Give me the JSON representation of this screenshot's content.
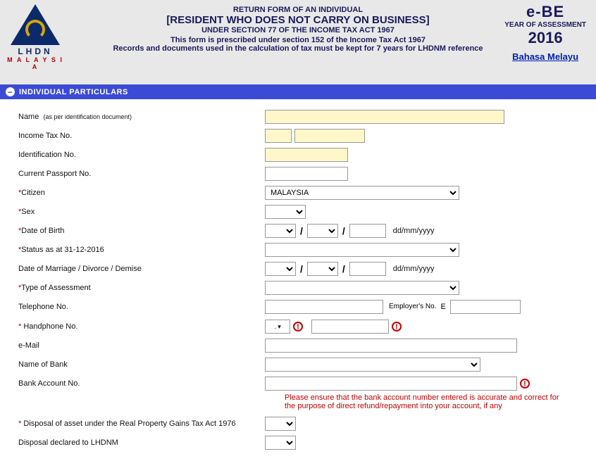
{
  "header": {
    "line1": "RETURN FORM OF AN INDIVIDUAL",
    "line2": "[RESIDENT WHO DOES NOT CARRY ON BUSINESS]",
    "line3": "UNDER SECTION 77 OF THE INCOME TAX ACT 1967",
    "line4": "This form is prescribed under section 152 of the Income Tax Act 1967",
    "line5": "Records and documents used in the calculation of tax must be kept for 7 years for LHDNM reference",
    "logo_lhdn": "LHDN",
    "logo_malaysia": "M A L A Y S I A",
    "ebe": "e-BE",
    "year_of": "YEAR OF ASSESSMENT",
    "year": "2016",
    "lang_link": "Bahasa Melayu"
  },
  "section": {
    "title": "INDIVIDUAL PARTICULARS"
  },
  "labels": {
    "name": "Name",
    "name_hint": "(as per identification document)",
    "income_tax_no": "Income Tax No.",
    "identification_no": "Identification No.",
    "passport": "Current Passport No.",
    "citizen": "Citizen",
    "sex": "Sex",
    "dob": "Date of Birth",
    "status": "Status as at 31-12-2016",
    "marriage": "Date of Marriage / Divorce / Demise",
    "assessment": "Type of Assessment",
    "telephone": "Telephone No.",
    "employers_no": "Employer's No.",
    "employers_prefix": "E",
    "handphone": "Handphone No.",
    "email": "e-Mail",
    "bank_name": "Name of Bank",
    "bank_acct": "Bank Account No.",
    "disposal_asset": "Disposal of asset under the Real Property Gains Tax Act 1976",
    "disposal_declared": "Disposal declared to LHDNM",
    "date_hint": "dd/mm/yyyy",
    "hp_prefix": ". ▾"
  },
  "values": {
    "citizen": "MALAYSIA"
  },
  "notes": {
    "bank": "Please ensure that the bank account number entered is accurate and correct for the purpose of direct refund/repayment into your account, if any"
  }
}
